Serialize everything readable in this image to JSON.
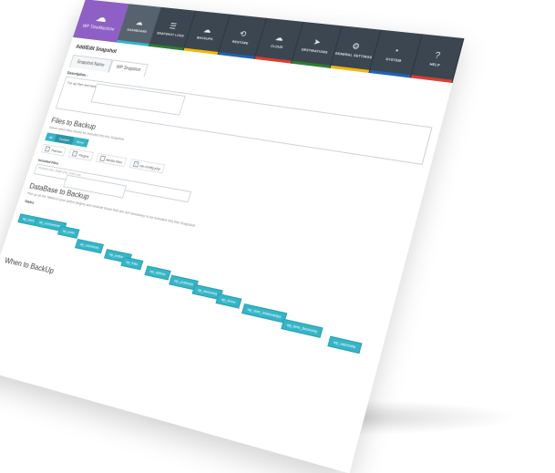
{
  "app": {
    "brand_name": "WP TimeMachine",
    "page_title": "Add/Edit Snapshot",
    "accent_color": "#8e5fc4",
    "topbar_color": "#3b4650"
  },
  "nav": [
    {
      "label": "DASHBOARD",
      "icon": "cloud-icon",
      "glyph": "☁",
      "stripe": "#35b5c7",
      "active": true
    },
    {
      "label": "SNAPSHOT LOGS",
      "icon": "list-icon",
      "glyph": "☰",
      "stripe": "#2e7d32",
      "active": false
    },
    {
      "label": "BACKUPS",
      "icon": "cloud-upload-icon",
      "glyph": "☁",
      "stripe": "#f2b705",
      "active": false
    },
    {
      "label": "RESTORE",
      "icon": "restore-icon",
      "glyph": "⟲",
      "stripe": "#1e63b6",
      "active": false
    },
    {
      "label": "CLOUD",
      "icon": "cloud-icon",
      "glyph": "☁",
      "stripe": "#e23b2e",
      "active": false
    },
    {
      "label": "DESTINATIONS",
      "icon": "send-icon",
      "glyph": "➤",
      "stripe": "#2e7d32",
      "active": false
    },
    {
      "label": "GENERAL SETTINGS",
      "icon": "gear-icon",
      "glyph": "⚙",
      "stripe": "#f2b705",
      "active": false
    },
    {
      "label": "SYSTEM",
      "icon": "gauge-icon",
      "glyph": "◔",
      "stripe": "#1e63b6",
      "active": false
    },
    {
      "label": "HELP",
      "icon": "help-icon",
      "glyph": "?",
      "stripe": "#e23b2e",
      "active": false
    }
  ],
  "form": {
    "tabs": [
      "Snapshot Name",
      "WP Snapshot"
    ],
    "description_label": "Description :",
    "description_value": "The wp files and backup WP tables are stored during this snapshot",
    "files_title": "Files to Backup",
    "files_sub": "Select which files should be included into the Snapshot",
    "scope_segments": [
      "All",
      "Custom",
      "None"
    ],
    "checks": [
      "Themes",
      "Plugins",
      "Media Files",
      "wp-config.php"
    ],
    "included_label": "Included Files",
    "included_placeholder": "example.php, single.php, index.css",
    "db_title": "DataBase to Backup",
    "db_sub": "Pick up all the Tables in your active plugins and exclude those that are not necessary to be included into this Snapshot",
    "tables_label": "Tables",
    "tables": [
      "wp_users",
      "wp_commentmeta",
      "wp_posts",
      "wp_comments",
      "wp_postmeta",
      "wp_links",
      "wp_options",
      "wp_postmeta",
      "wp_termmeta",
      "wp_terms",
      "wp_term_relationships",
      "wp_term_taxonomy",
      "wp_usermeta"
    ],
    "when_title": "When to BackUp"
  }
}
